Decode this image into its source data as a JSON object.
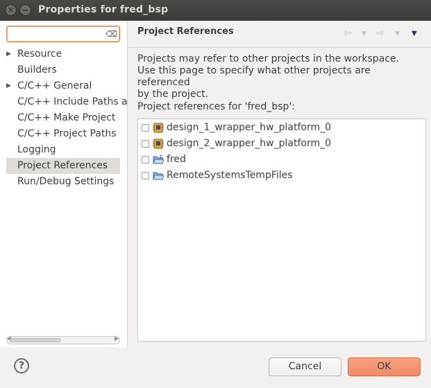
{
  "window": {
    "title": "Properties for fred_bsp"
  },
  "filter": {
    "value": "",
    "placeholder": ""
  },
  "nav": {
    "items": [
      {
        "label": "Resource",
        "expandable": true
      },
      {
        "label": "Builders",
        "expandable": false
      },
      {
        "label": "C/C++ General",
        "expandable": true
      },
      {
        "label": "C/C++ Include Paths ar",
        "expandable": false
      },
      {
        "label": "C/C++ Make Project",
        "expandable": false
      },
      {
        "label": "C/C++ Project Paths",
        "expandable": false
      },
      {
        "label": "Logging",
        "expandable": false
      },
      {
        "label": "Project References",
        "expandable": false,
        "selected": true
      },
      {
        "label": "Run/Debug Settings",
        "expandable": false
      }
    ]
  },
  "page": {
    "title": "Project References",
    "description_line1": "Projects may refer to other projects in the workspace.",
    "description_line2": "Use this page to specify what other projects are referenced",
    "description_line3": "by the project.",
    "refs_label": "Project references for 'fred_bsp':"
  },
  "projects": [
    {
      "name": "design_1_wrapper_hw_platform_0",
      "icon": "hw-platform-icon",
      "checked": false
    },
    {
      "name": "design_2_wrapper_hw_platform_0",
      "icon": "hw-platform-icon",
      "checked": false
    },
    {
      "name": "fred",
      "icon": "c-project-folder-icon",
      "checked": false
    },
    {
      "name": "RemoteSystemsTempFiles",
      "icon": "open-folder-icon",
      "checked": false
    }
  ],
  "footer": {
    "help": "?",
    "cancel_label": "Cancel",
    "ok_label": "OK"
  },
  "colors": {
    "accent": "#e8833a",
    "ok_button": "#f08b67",
    "titlebar": "#3c3b37"
  }
}
